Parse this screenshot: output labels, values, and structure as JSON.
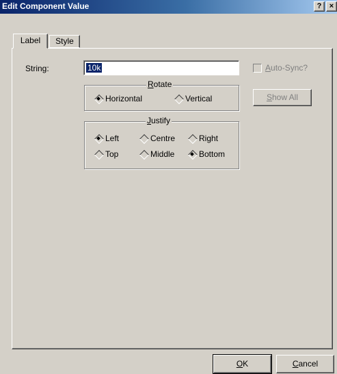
{
  "window": {
    "title": "Edit Component Value",
    "help_glyph": "?",
    "close_glyph": "×"
  },
  "tabs": [
    {
      "label": "Label",
      "active": true
    },
    {
      "label": "Style",
      "active": false
    }
  ],
  "fields": {
    "string_label": "String:",
    "string_value": "10k",
    "autosync_label": "Auto-Sync?",
    "autosync_checked": false
  },
  "buttons": {
    "show_all": "Show All",
    "ok": "OK",
    "cancel": "Cancel"
  },
  "rotate": {
    "title": "Rotate",
    "options": [
      {
        "label": "Horizontal",
        "selected": true
      },
      {
        "label": "Vertical",
        "selected": false
      }
    ]
  },
  "justify": {
    "title": "Justify",
    "options": [
      {
        "label": "Left",
        "selected": true
      },
      {
        "label": "Centre",
        "selected": false
      },
      {
        "label": "Right",
        "selected": false
      },
      {
        "label": "Top",
        "selected": false
      },
      {
        "label": "Middle",
        "selected": false
      },
      {
        "label": "Bottom",
        "selected": true
      }
    ]
  },
  "colors": {
    "titlebar_start": "#0a246a",
    "titlebar_end": "#a6caf0",
    "face": "#d4d0c8",
    "selection": "#0a246a"
  }
}
